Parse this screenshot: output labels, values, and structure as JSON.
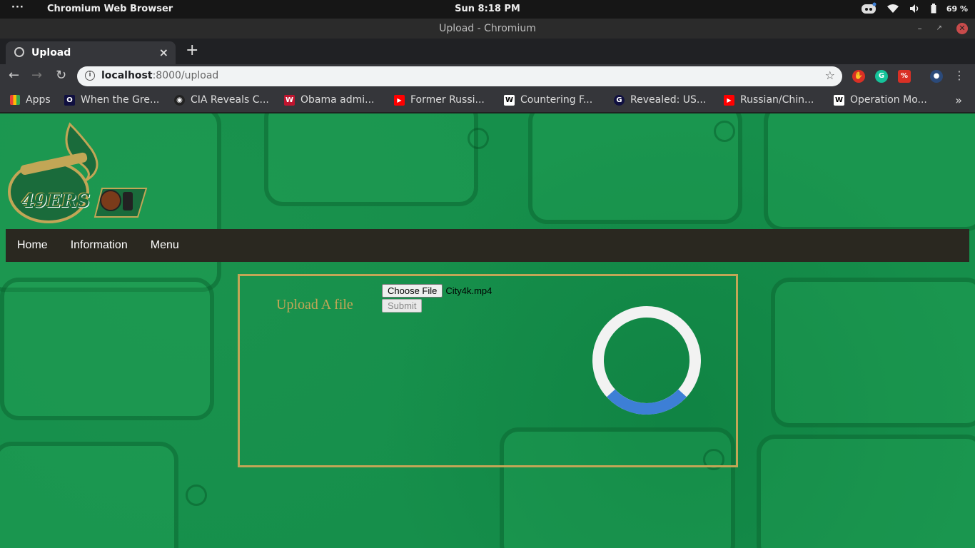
{
  "os_bar": {
    "menu_dots": "···",
    "app_name": "Chromium Web Browser",
    "clock": "Sun  8:18 PM",
    "battery": "69 %"
  },
  "window": {
    "title": "Upload - Chromium"
  },
  "tab": {
    "title": "Upload",
    "close": "×",
    "new_tab": "+"
  },
  "address_bar": {
    "host": "localhost",
    "path": ":8000/upload",
    "info": "i"
  },
  "bookmarks": [
    {
      "label": "Apps",
      "icon": "apps-grid-icon"
    },
    {
      "label": "When the Gre...",
      "icon": "o-icon"
    },
    {
      "label": "CIA Reveals C...",
      "icon": "eye-icon"
    },
    {
      "label": "Obama admi...",
      "icon": "w-logo-icon"
    },
    {
      "label": "Former Russi...",
      "icon": "youtube-icon"
    },
    {
      "label": "Countering F...",
      "icon": "wikipedia-icon"
    },
    {
      "label": "Revealed: US...",
      "icon": "g-icon"
    },
    {
      "label": "Russian/Chin...",
      "icon": "youtube-icon"
    },
    {
      "label": "Operation Mo...",
      "icon": "wikipedia-icon"
    }
  ],
  "site": {
    "logo_text": "49ERS",
    "nav": [
      "Home",
      "Information",
      "Menu"
    ],
    "upload": {
      "label": "Upload A file",
      "choose_button": "Choose File",
      "file_name": "City4k.mp4",
      "submit_button": "Submit"
    }
  },
  "colors": {
    "page_green": "#168f4b",
    "gold": "#c2a656",
    "navbar": "#2a2820",
    "spinner_track": "#f2f2f2",
    "spinner_arc": "#3d7fd6"
  }
}
